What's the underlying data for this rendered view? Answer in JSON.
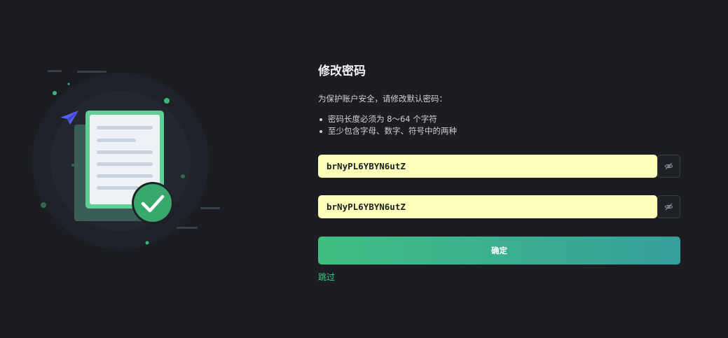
{
  "dialog": {
    "title": "修改密码",
    "description": "为保护账户安全，请修改默认密码：",
    "rules": [
      "密码长度必须为 8～64 个字符",
      "至少包含字母、数字、符号中的两种"
    ],
    "password": {
      "value": "brNyPL6YBYN6utZ",
      "toggle_icon": "eye-off-icon"
    },
    "confirm_password": {
      "value": "brNyPL6YBYN6utZ",
      "toggle_icon": "eye-off-icon"
    },
    "confirm_label": "确定",
    "skip_label": "跳过"
  },
  "colors": {
    "background": "#1b1d22",
    "accent": "#3ecf85",
    "input_autofill": "#fbffb9",
    "button_gradient_start": "#3fbf82",
    "button_gradient_end": "#379f9c"
  }
}
